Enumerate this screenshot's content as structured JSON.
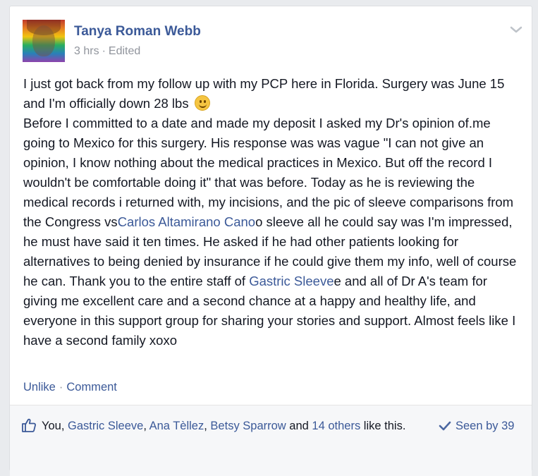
{
  "post": {
    "author": "Tanya Roman Webb",
    "time": "3 hrs",
    "meta_separator": "·",
    "edited": "Edited",
    "paragraphs": [
      {
        "segments": [
          {
            "text": "I just got back from my follow up with my PCP here in Florida. Surgery was June 15 and I'm officially down 28 lbs "
          },
          {
            "emoji": "smiley-face"
          }
        ]
      },
      {
        "segments": [
          {
            "text": "Before I committed to a date and made my deposit I asked my Dr's opinion of.me going to Mexico for this surgery. His response was was vague \"I can not give an opinion, I know nothing about the medical practices in Mexico. But off the record I wouldn't be comfortable doing it\" that was before. Today as he is reviewing the medical records i returned with, my incisions, and the pic of sleeve comparisons from the Congress vs"
          },
          {
            "link": "Carlos Altamirano Cano"
          },
          {
            "text": "o sleeve all he could say was I'm impressed, he must have said it ten times. He asked if he had other patients looking for alternatives to being denied by insurance if he could give them my info, well of course he can. Thank you to the entire staff of "
          },
          {
            "link": "Gastric Sleeve"
          },
          {
            "text": "e and all of Dr A's team for giving me excellent care and a second chance at a happy and healthy life, and everyone in this support group for sharing your stories and support. Almost feels like I have a second family xoxo"
          }
        ]
      }
    ],
    "actions": {
      "unlike": "Unlike",
      "separator": "·",
      "comment": "Comment"
    },
    "likes": {
      "segments": [
        {
          "text": "You, "
        },
        {
          "link": "Gastric Sleeve"
        },
        {
          "text": ", "
        },
        {
          "link": "Ana Tèllez"
        },
        {
          "text": ", "
        },
        {
          "link": "Betsy Sparrow"
        },
        {
          "text": " and "
        },
        {
          "link": "14 others"
        },
        {
          "text": " like this."
        }
      ]
    },
    "seen": "Seen by 39"
  },
  "icons": {
    "menu": "chevron-down-icon",
    "like": "thumbs-up-icon",
    "seen": "checkmark-icon",
    "emoji": "smiley-face-icon"
  },
  "colors": {
    "link": "#3b5998",
    "text": "#141823",
    "muted": "#90949c",
    "footer_bg": "#f6f7f9",
    "page_bg": "#e9ebee"
  }
}
